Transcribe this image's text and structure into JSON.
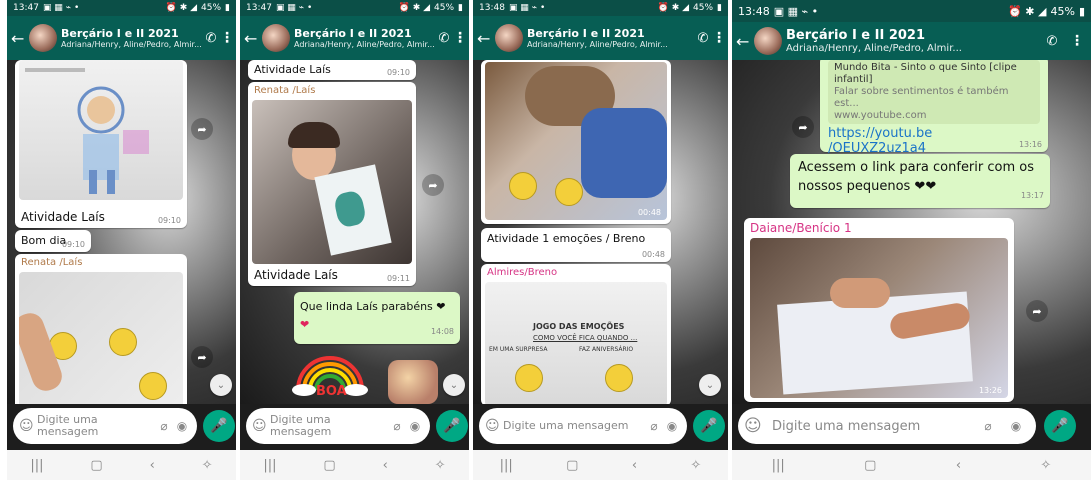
{
  "chat": {
    "title": "Berçário I e II 2021",
    "subtitle": "Adriana/Henry, Aline/Pedro, Almir..."
  },
  "input": {
    "placeholder": "Digite uma mensagem"
  },
  "screens": [
    {
      "status_time": "13:47",
      "status_batt": "45%",
      "messages": {
        "m1_caption": "Atividade Laís",
        "m1_time": "09:10",
        "m2_text": "Bom dia",
        "m2_time": "09:10",
        "m3_sender": "Renata /Laís"
      }
    },
    {
      "status_time": "13:47",
      "status_batt": "45%",
      "messages": {
        "m1_text": "Atividade Laís",
        "m1_time": "09:10",
        "m2_sender": "Renata /Laís",
        "m2_caption": "Atividade Laís",
        "m2_time": "09:11",
        "m3_text": "Que linda Laís parabéns ❤",
        "m3_text2": "❤",
        "m3_time": "14:08",
        "sticker_text": "BOA"
      }
    },
    {
      "status_time": "13:48",
      "status_batt": "45%",
      "messages": {
        "m1_time": "00:48",
        "m2_text": "Atividade 1 emoções / Breno",
        "m2_time": "00:48",
        "m3_sender": "Almires/Breno",
        "doc_title": "JOGO DAS EMOÇÕES",
        "doc_sub": "COMO VOCÊ FICA QUANDO ...",
        "doc_l": "EM UMA SURPRESA",
        "doc_r": "FAZ ANIVERSÁRIO"
      }
    },
    {
      "status_time": "13:48",
      "status_batt": "45%",
      "messages": {
        "link_title": "Mundo Bita - Sinto o que Sinto [clipe infantil]",
        "link_desc": "Falar sobre sentimentos é também est...",
        "link_domain": "www.youtube.com",
        "link_url": "https://youtu.be /OEUXZ2uz1a4",
        "m1_time": "13:16",
        "m2_text": "Acessem o link para conferir com os nossos pequenos ❤❤",
        "m2_time": "13:17",
        "m3_sender": "Daiane/Benício 1",
        "m3_time": "13:26"
      }
    }
  ],
  "colors": {
    "header": "#075e54",
    "outgoing": "#dcf8c6",
    "accent": "#00a884",
    "sender_pink": "#d63384",
    "sender_brown": "#b07a4a"
  }
}
